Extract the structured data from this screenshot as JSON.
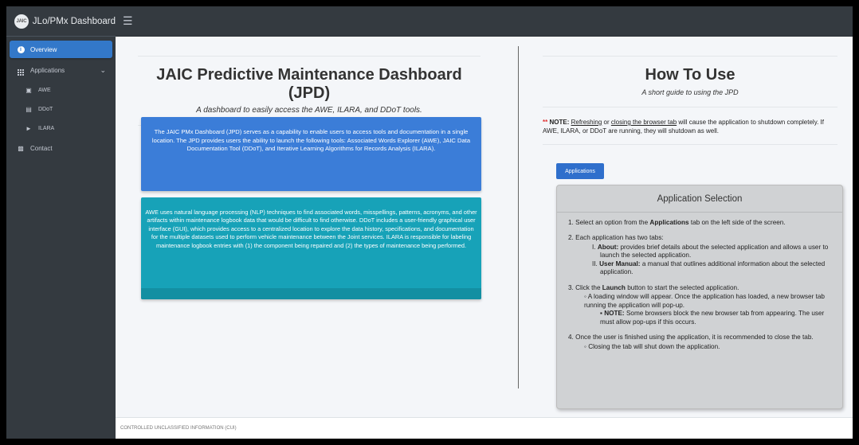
{
  "brand": {
    "logo_text": "JAIC",
    "title": "JLo/PMx Dashboard"
  },
  "topbar": {
    "menu_icon": "hamburger-icon"
  },
  "sidebar": {
    "items": [
      {
        "label": "Overview",
        "icon": "info-icon",
        "active": true
      },
      {
        "label": "Applications",
        "icon": "grid-icon",
        "expandable": true
      },
      {
        "label": "AWE",
        "icon": "id-card-icon",
        "sub": true
      },
      {
        "label": "DDoT",
        "icon": "file-icon",
        "sub": true
      },
      {
        "label": "ILARA",
        "icon": "tag-icon",
        "sub": true
      },
      {
        "label": "Contact",
        "icon": "contact-card-icon"
      }
    ]
  },
  "main": {
    "left": {
      "title": "JAIC Predictive Maintenance Dashboard (JPD)",
      "subtitle": "A dashboard to easily access the AWE, ILARA, and DDoT tools.",
      "blue_card": "The JAIC PMx Dashboard (JPD) serves as a capability to enable users to access tools and documentation in a single location. The JPD provides users the ability to launch the following tools: Associated Words Explorer (AWE), JAIC Data Documentation Tool (DDoT), and Iterative Learning Algorithms for Records Analysis (ILARA).",
      "teal_card": "AWE uses natural language processing (NLP) techniques to find associated words, misspellings, patterns, acronyms, and other artifacts within maintenance logbook data that would be difficult to find otherwise. DDoT includes a user-friendly graphical user interface (GUI), which provides access to a centralized location to explore the data history, specifications, and documentation for the multiple datasets used to perform vehicle maintenance between the Joint services. ILARA is responsible for labeling maintenance logbook entries with (1) the component being repaired and (2) the types of maintenance being performed."
    },
    "right": {
      "title": "How To Use",
      "subtitle": "A short guide to using the JPD",
      "note": {
        "stars": "**",
        "label": "NOTE:",
        "link1": "Refreshing",
        "or": "or",
        "link2": "closing the browser tab",
        "rest": "will cause the application to shutdown completely. If AWE, ILARA, or DDoT are running, they will shutdown as well."
      },
      "tab_button": "Applications",
      "guide": {
        "title": "Application Selection",
        "step1_pre": "1. Select an option from the",
        "step1_bold": "Applications",
        "step1_post": "tab on the left side of the screen.",
        "step2": "2. Each application has two tabs:",
        "step2_i_num": "I.",
        "step2_i_bold": "About:",
        "step2_i_text": "provides brief details about the selected application and allows a user to launch the selected application.",
        "step2_ii_num": "II.",
        "step2_ii_bold": "User Manual:",
        "step2_ii_text": "a manual that outlines additional information about the selected application.",
        "step3_pre": "3. Click the",
        "step3_bold": "Launch",
        "step3_post": "button to start the selected application.",
        "step3_sub": "A loading window will appear. Once the application has loaded, a new browser tab running the application will pop-up.",
        "step3_note_bold": "NOTE:",
        "step3_note_text": "Some browsers block the new browser tab from appearing. The user must allow pop-ups if this occurs.",
        "step4": "4. Once the user is finished using the application, it is recommended to close the tab.",
        "step4_sub": "Closing the tab will shut down the application."
      }
    }
  },
  "footer": {
    "text": "CONTROLLED UNCLASSIFIED INFORMATION (CUI)"
  }
}
